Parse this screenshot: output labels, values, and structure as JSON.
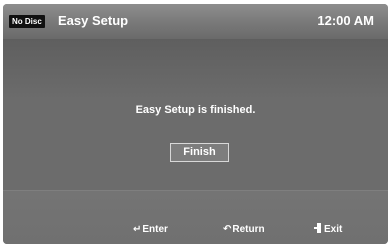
{
  "header": {
    "badge": "No Disc",
    "title": "Easy Setup",
    "clock": "12:00 AM"
  },
  "dialog": {
    "message": "Easy Setup is finished.",
    "button_label": "Finish"
  },
  "footer": {
    "enter": {
      "icon": "enter-icon",
      "label": "Enter"
    },
    "return": {
      "icon": "return-icon",
      "label": "Return"
    },
    "exit": {
      "icon": "exit-icon",
      "label": "Exit"
    }
  },
  "colors": {
    "background": "#6d6d6d",
    "header": "#7a7a7a",
    "text": "#ffffff",
    "badge": "#111111"
  }
}
